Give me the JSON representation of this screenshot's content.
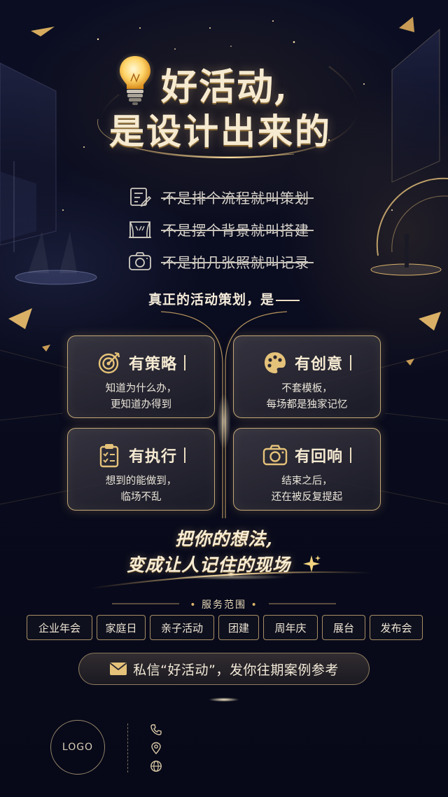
{
  "title": {
    "line1": "好活动,",
    "line2": "是设计出来的"
  },
  "negations": [
    {
      "icon": "edit-list-icon",
      "text": "不是排个流程就叫策划"
    },
    {
      "icon": "stage-backdrop-icon",
      "text": "不是摆个背景就叫搭建"
    },
    {
      "icon": "camera-icon",
      "text": "不是拍几张照就叫记录"
    }
  ],
  "subhead": "真正的活动策划，是",
  "cards": [
    {
      "icon": "target-icon",
      "title": "有策略",
      "line1": "知道为什么办，",
      "line2": "更知道办得到"
    },
    {
      "icon": "palette-icon",
      "title": "有创意",
      "line1": "不套模板，",
      "line2": "每场都是独家记忆"
    },
    {
      "icon": "clipboard-check-icon",
      "title": "有执行",
      "line1": "想到的能做到，",
      "line2": "临场不乱"
    },
    {
      "icon": "camera-icon",
      "title": "有回响",
      "line1": "结束之后，",
      "line2": "还在被反复提起"
    }
  ],
  "slogan": {
    "line1": "把你的想法,",
    "line2": "变成让人记住的现场"
  },
  "services": {
    "title": "服务范围",
    "tags": [
      "企业年会",
      "家庭日",
      "亲子活动",
      "团建",
      "周年庆",
      "展台",
      "发布会"
    ]
  },
  "cta": {
    "icon": "mail-icon",
    "text": "私信“好活动”，发你往期案例参考"
  },
  "footer": {
    "logo": "LOGO",
    "contacts": [
      "phone-icon",
      "location-icon",
      "globe-icon"
    ]
  },
  "colors": {
    "background": "#0a0c1f",
    "gold": "#d9b26a",
    "text": "#f3e6c8"
  }
}
